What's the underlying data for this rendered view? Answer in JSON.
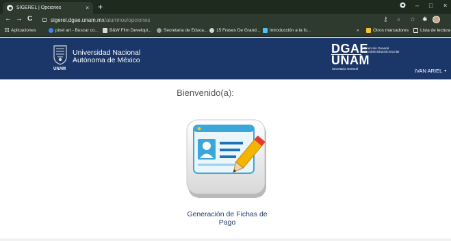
{
  "browser": {
    "tab_title": "SIGEREL | Opciones",
    "tab_close": "×",
    "new_tab": "+",
    "window_controls": [
      "–",
      "□",
      "×"
    ],
    "url_host": "sigerel.dgae.unam.mx",
    "url_path": "/alumnos/opciones",
    "nav": {
      "back": "←",
      "forward": "→",
      "reload": "C"
    }
  },
  "bookmarks": {
    "apps": "Aplicaciones",
    "items": [
      "pixel art - Buscar co...",
      "B&W Film Developi...",
      "Secretaria de Educa...",
      "15 Frases De Grand...",
      "Introducción a la fo..."
    ],
    "overflow": "»",
    "others": "Otros marcadores",
    "reading_list": "Lista de lectura"
  },
  "header": {
    "univ_line1": "Universidad Nacional",
    "univ_line2": "Autónoma de México",
    "unam_small": "UNAM",
    "dgae": "DGAE",
    "unam": "UNAM",
    "dgae_sub_line1": "Dirección General",
    "dgae_sub_line2": "de Administración Escolar",
    "secretaria": "Secretaría General",
    "user": "IVAN ARIEL",
    "user_caret": "▾"
  },
  "main": {
    "welcome": "Bienvenido(a):",
    "option_label_line1": "Generación de Fichas de",
    "option_label_line2": "Pago"
  }
}
